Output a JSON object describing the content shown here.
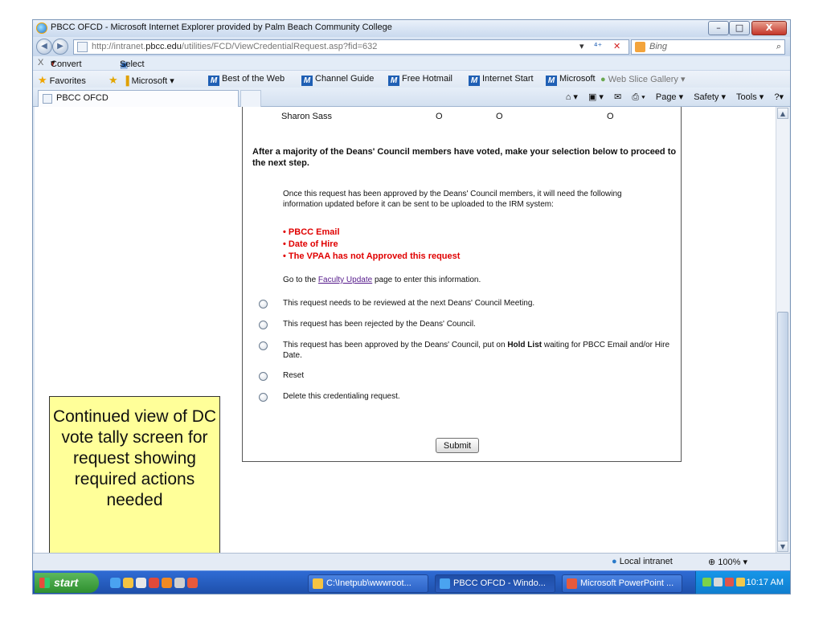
{
  "window": {
    "title": "PBCC OFCD - Microsoft Internet Explorer provided by Palm Beach Community College",
    "min_glyph": "–",
    "max_glyph": "□",
    "close_glyph": "X"
  },
  "address_bar": {
    "url_prefix": "http://intranet.",
    "url_domain": "pbcc.edu",
    "url_path": "/utilities/FCD/ViewCredentialRequest.asp?fid=632",
    "search_placeholder": "Bing",
    "dropdown_glyph": "▾",
    "refresh_glyph": "⁴⁺",
    "stop_glyph": "✕",
    "search_glyph": "⌕"
  },
  "convert_bar": {
    "close": "X",
    "convert": "Convert",
    "select": "Select"
  },
  "favorites_bar": {
    "favorites": "Favorites",
    "items": [
      "Microsoft ▾",
      "Best of the Web",
      "Channel Guide",
      "Free Hotmail",
      "Internet Start",
      "Microsoft",
      "Web Slice Gallery ▾"
    ]
  },
  "tabs": [
    {
      "label": "PBCC OFCD"
    }
  ],
  "command_bar": {
    "page": "Page ▾",
    "safety": "Safety ▾",
    "tools": "Tools ▾",
    "help": "?▾"
  },
  "vote_row": {
    "name": "Sharon Sass",
    "votes": [
      "O",
      "O",
      "O"
    ]
  },
  "instruction": "After a majority of the Deans' Council members have voted, make your selection below to proceed to the next step.",
  "info_text": "Once this request has been approved by the Deans' Council members, it will need the following information updated before it can be sent to be uploaded to the IRM system:",
  "required_items": [
    "PBCC Email",
    "Date of Hire",
    "The VPAA has not Approved this request"
  ],
  "goto_text": {
    "before": "Go to the ",
    "link": "Faculty Update",
    "after": " page to enter this information."
  },
  "options": [
    {
      "text": "This request needs to be reviewed at the next Deans' Council Meeting."
    },
    {
      "text": "This request has been rejected by the Deans' Council."
    },
    {
      "text_before": "This request has been approved by the Deans' Council, put on ",
      "text_bold": "Hold List",
      "text_after": " waiting for PBCC Email and/or Hire Date."
    },
    {
      "text": "Reset"
    },
    {
      "text": "Delete this credentialing request."
    }
  ],
  "submit_label": "Submit",
  "callout": "Continued view of DC vote tally screen for request showing required actions needed",
  "status_bar": {
    "zone": "Local intranet",
    "zoom": "100%"
  },
  "taskbar": {
    "start": "start",
    "buttons": [
      "C:\\Inetpub\\wwwroot...",
      "PBCC OFCD - Windo...",
      "Microsoft PowerPoint ..."
    ],
    "clock": "10:17 AM"
  },
  "colors": {
    "required_red": "#e00000",
    "callout_yellow": "#ffff99",
    "link_purple": "#551a8b"
  }
}
